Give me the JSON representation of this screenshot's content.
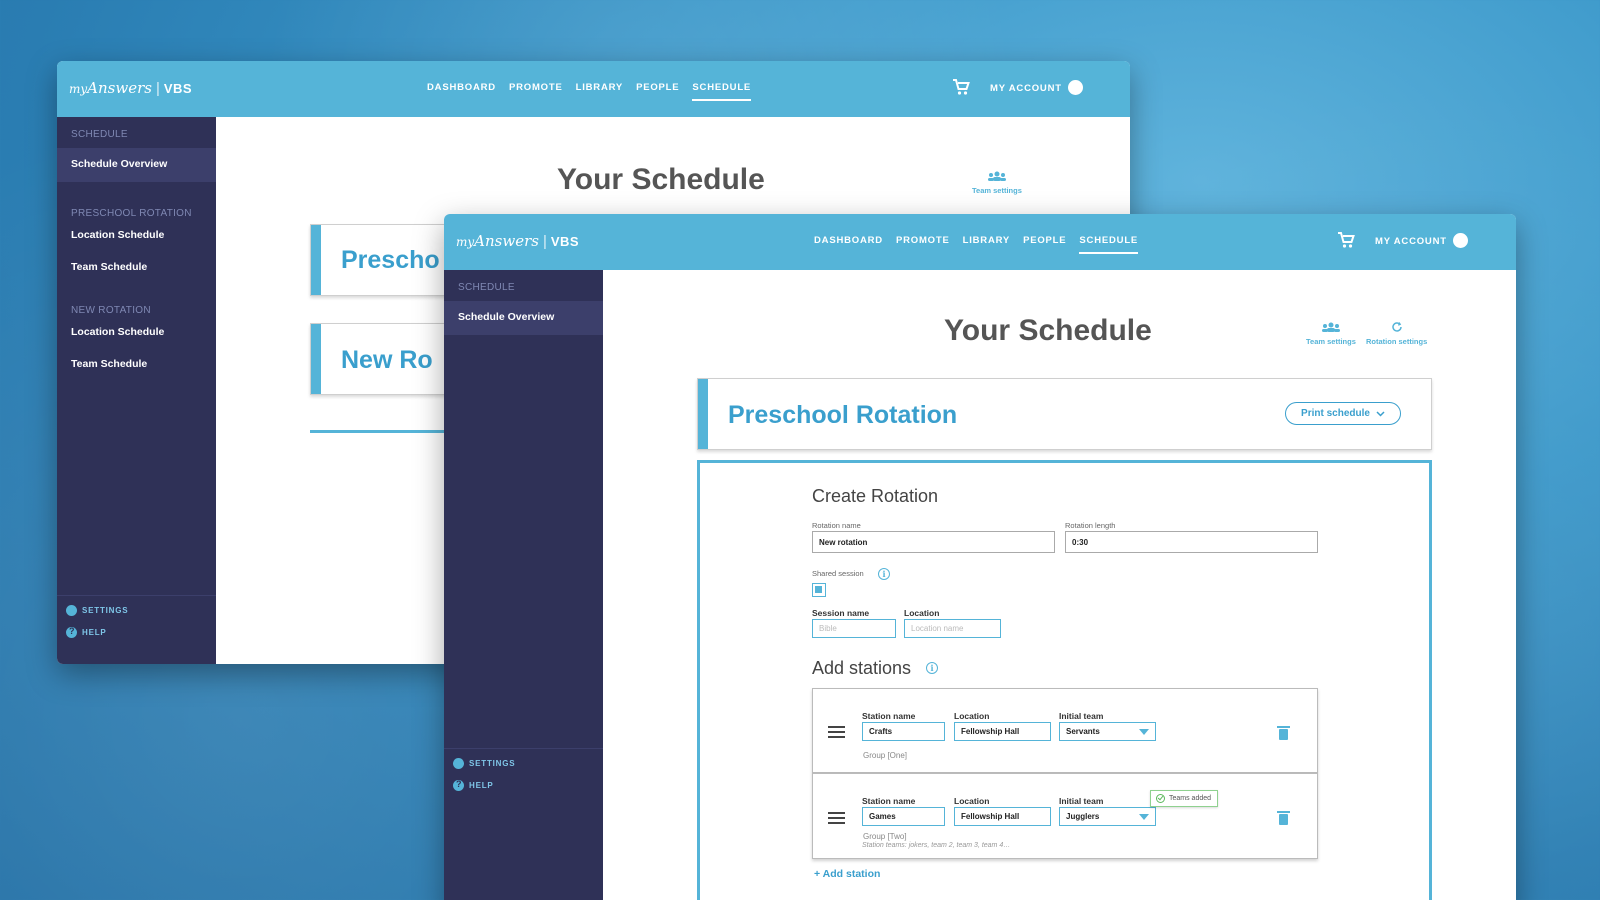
{
  "brand": {
    "my": "my",
    "answers": "Answers",
    "vbs": "VBS"
  },
  "nav": {
    "dashboard": "DASHBOARD",
    "promote": "PROMOTE",
    "library": "LIBRARY",
    "people": "PEOPLE",
    "schedule": "SCHEDULE"
  },
  "account": {
    "label": "MY ACCOUNT"
  },
  "sidebar": {
    "schedule_section": "SCHEDULE",
    "overview": "Schedule Overview",
    "preschool_section": "PRESCHOOL ROTATION",
    "new_section": "NEW ROTATION",
    "location_schedule": "Location Schedule",
    "team_schedule": "Team Schedule",
    "settings": "SETTINGS",
    "help": "HELP"
  },
  "main": {
    "title": "Your Schedule",
    "team_settings": "Team settings",
    "rotation_settings": "Rotation settings"
  },
  "back_cards": {
    "preschool": "Prescho",
    "new": "New Ro"
  },
  "rotation": {
    "title": "Preschool Rotation",
    "print": "Print schedule"
  },
  "create": {
    "heading": "Create Rotation",
    "name_label": "Rotation name",
    "name_value": "New rotation",
    "length_label": "Rotation length",
    "length_value": "0:30",
    "shared_label": "Shared session",
    "session_name_label": "Session name",
    "session_name_placeholder": "Bible",
    "location_label": "Location",
    "location_placeholder": "Location name"
  },
  "stations": {
    "heading": "Add stations",
    "col_station": "Station name",
    "col_location": "Location",
    "col_team": "Initial team",
    "rows": [
      {
        "name": "Crafts",
        "location": "Fellowship Hall",
        "team": "Servants",
        "group": "Group [One]"
      },
      {
        "name": "Games",
        "location": "Fellowship Hall",
        "team": "Jugglers",
        "group": "Group [Two]",
        "teams_note": "Station teams: jokers, team 2, team 3, team 4…"
      }
    ],
    "teams_added": "Teams added",
    "add": "+ Add station"
  },
  "colors": {
    "accent": "#55b4d8",
    "sidebar": "#2f3157",
    "heading": "#3a9fcd"
  }
}
